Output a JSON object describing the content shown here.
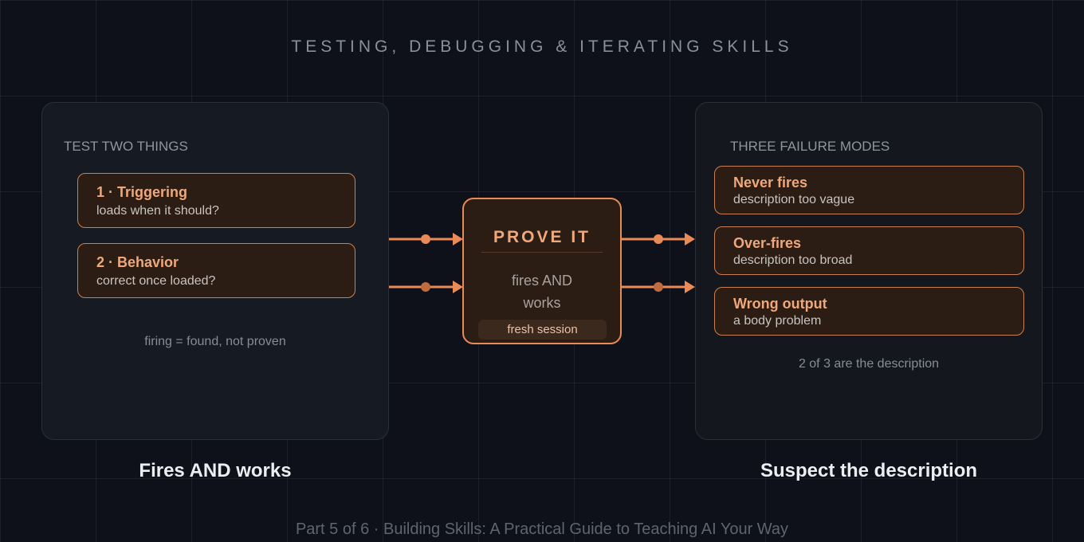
{
  "title": "TESTING, DEBUGGING & ITERATING SKILLS",
  "left_panel": {
    "heading": "TEST TWO THINGS",
    "cards": [
      {
        "title": "1 · Triggering",
        "subtitle": "loads when it should?"
      },
      {
        "title": "2 · Behavior",
        "subtitle": "correct once loaded?"
      }
    ],
    "note": "firing = found, not proven",
    "caption": "Fires AND works"
  },
  "center": {
    "title": "PROVE IT",
    "line1": "fires AND",
    "line2": "works",
    "chip": "fresh session"
  },
  "right_panel": {
    "heading": "THREE FAILURE MODES",
    "cards": [
      {
        "title": "Never fires",
        "subtitle": "description too vague"
      },
      {
        "title": "Over-fires",
        "subtitle": "description too broad"
      },
      {
        "title": "Wrong output",
        "subtitle": "a body problem"
      }
    ],
    "note": "2 of 3 are the description",
    "caption": "Suspect the description"
  },
  "footer": "Part 5 of 6 · Building Skills: A Practical Guide to Teaching AI Your Way",
  "colors": {
    "background": "#0e1119",
    "accent": "#e98a57",
    "card_fill": "#2c1d14",
    "card_title": "#f0a87a"
  }
}
